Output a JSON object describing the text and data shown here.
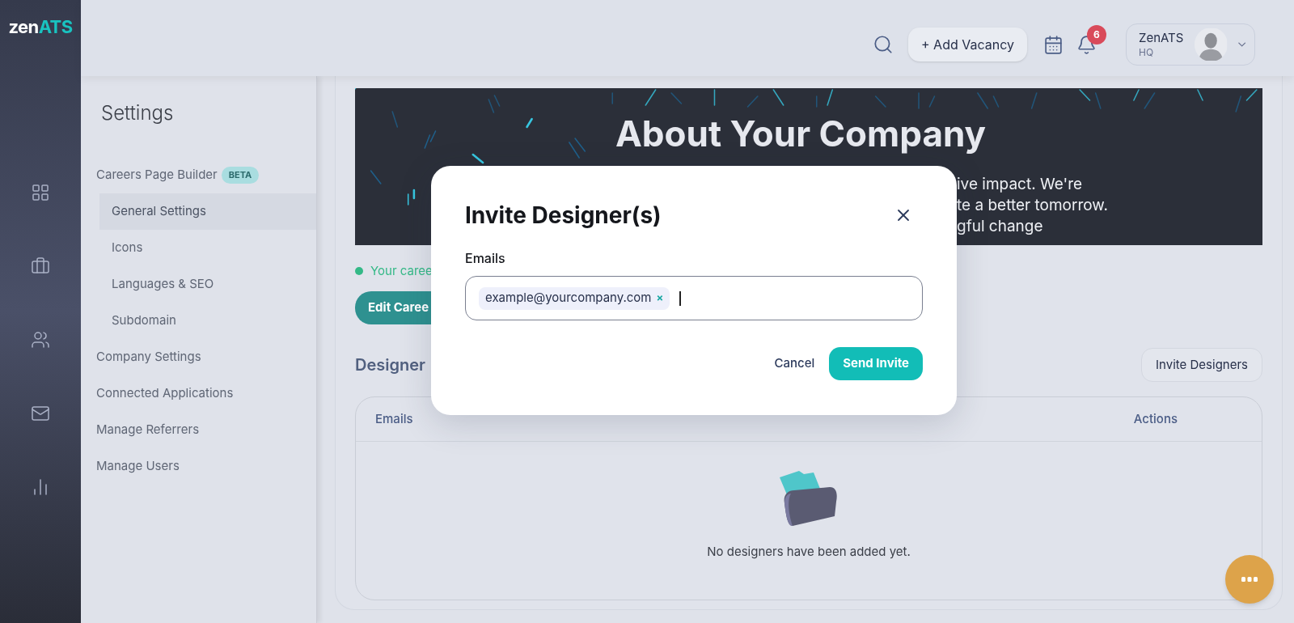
{
  "logo": {
    "part_1": "zen",
    "part_2": "ATS"
  },
  "rail": [
    {
      "kind": "grid"
    },
    {
      "kind": "briefcase"
    },
    {
      "kind": "users"
    },
    {
      "kind": "mail"
    },
    {
      "kind": "chart"
    }
  ],
  "header": {
    "add_button": "+ Add Vacancy",
    "notification_count": "6",
    "user": {
      "name": "ZenATS",
      "org": "HQ"
    }
  },
  "settings": {
    "title": "Settings",
    "items": [
      {
        "label": "Careers Page Builder",
        "badge": "BETA",
        "selected": false,
        "children": [
          {
            "label": "General Settings",
            "selected": true
          },
          {
            "label": "Icons",
            "selected": false
          },
          {
            "label": "Languages & SEO",
            "selected": false
          },
          {
            "label": "Subdomain",
            "selected": false
          }
        ]
      },
      {
        "label": "Company Settings",
        "selected": false
      },
      {
        "label": "Connected Applications",
        "selected": false
      },
      {
        "label": "Manage Referrers",
        "selected": false
      },
      {
        "label": "Manage Users",
        "selected": false
      }
    ]
  },
  "preview": {
    "heading": "About Your Company",
    "lines": [
      "ive impact. We're",
      "te a better tomorrow.",
      "gful change"
    ]
  },
  "status": "Your caree",
  "edit_button": "Edit Caree",
  "designers": {
    "title": "Designer",
    "invite_button": "Invite Designers",
    "columns": [
      "Emails",
      "Actions"
    ],
    "empty_message": "No designers have been added yet."
  },
  "modal": {
    "title": "Invite Designer(s)",
    "field_label": "Emails",
    "chips": [
      {
        "text": "example@yourcompany.com",
        "remove": "×"
      }
    ],
    "cancel": "Cancel",
    "submit": "Send Invite"
  }
}
